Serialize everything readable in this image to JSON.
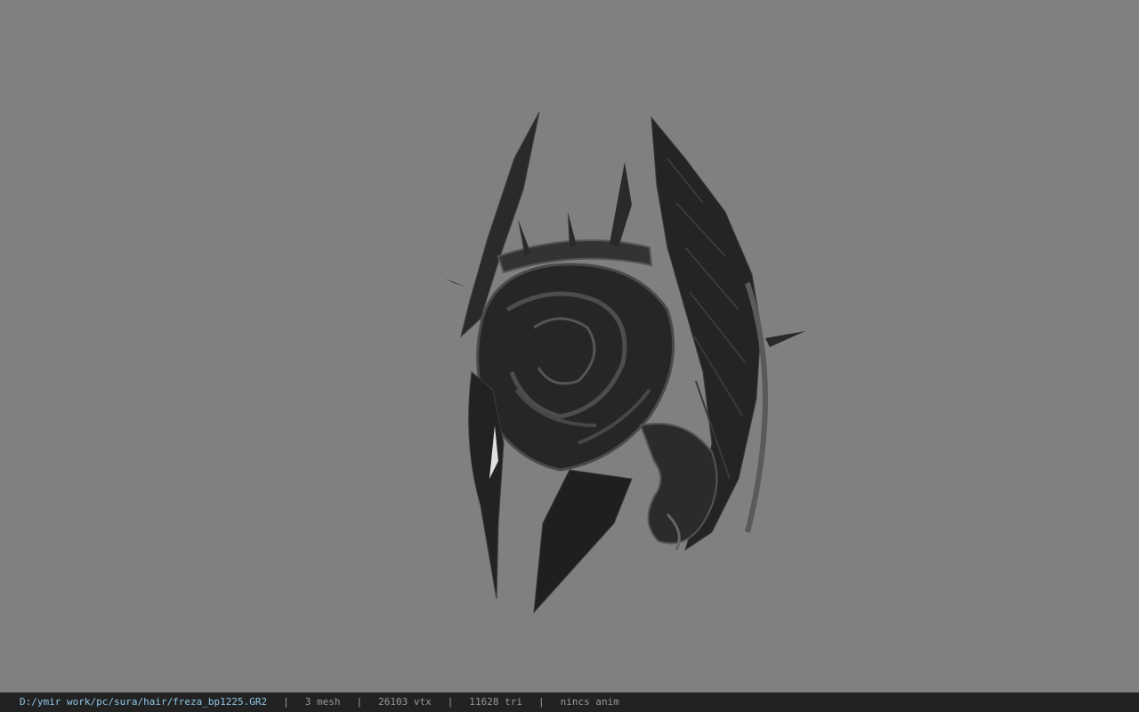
{
  "viewer": {
    "background_color": "#808080",
    "model_icon": "dark-helmet-model"
  },
  "status": {
    "file_path": "D:/ymir work/pc/sura/hair/freza_bp1225.GR2",
    "separator": "|",
    "mesh": "3 mesh",
    "vertices": "26103 vtx",
    "triangles": "11628 tri",
    "animation": "nincs anim",
    "path_color": "#8fc8e8",
    "bar_color": "#222222"
  }
}
